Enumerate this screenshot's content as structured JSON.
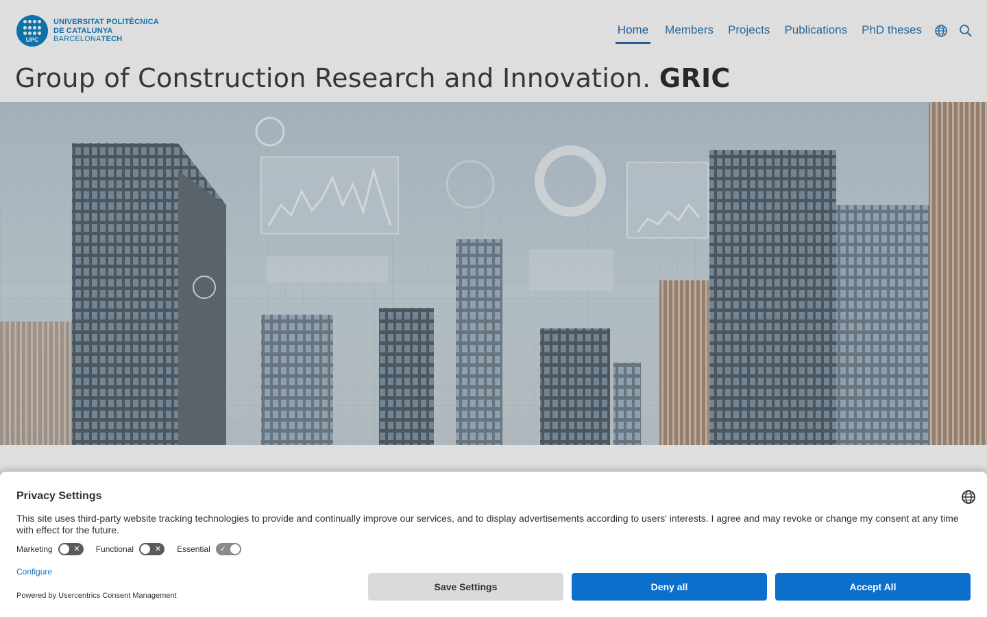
{
  "logo": {
    "badge_text": "UPC",
    "line1": "UNIVERSITAT POLITÈCNICA",
    "line2": "DE CATALUNYA",
    "line3_light": "BARCELONA",
    "line3_bold": "TECH"
  },
  "nav": {
    "items": [
      {
        "label": "Home",
        "active": true
      },
      {
        "label": "Members"
      },
      {
        "label": "Projects"
      },
      {
        "label": "Publications"
      },
      {
        "label": "PhD theses"
      }
    ],
    "icons": [
      "globe-icon",
      "search-icon"
    ]
  },
  "page": {
    "title_regular": "Group of Construction Research and Innovation.",
    "title_bold": "GRIC"
  },
  "cookie_banner": {
    "title": "Privacy Settings",
    "description": "This site uses third-party website tracking technologies to provide and continually improve our services, and to display advertisements according to users' interests. I agree and may revoke or change my consent at any time with effect for the future.",
    "toggles": [
      {
        "label": "Marketing",
        "state": "off"
      },
      {
        "label": "Functional",
        "state": "off"
      },
      {
        "label": "Essential",
        "state": "on"
      }
    ],
    "configure_label": "Configure",
    "powered_by": "Powered by Usercentrics Consent Management",
    "buttons": {
      "save": "Save Settings",
      "deny": "Deny all",
      "accept": "Accept All"
    }
  },
  "colors": {
    "brand_blue": "#007bc0",
    "nav_link": "#1f6fb0",
    "button_primary": "#0b6fcb",
    "button_secondary": "#dadada"
  }
}
